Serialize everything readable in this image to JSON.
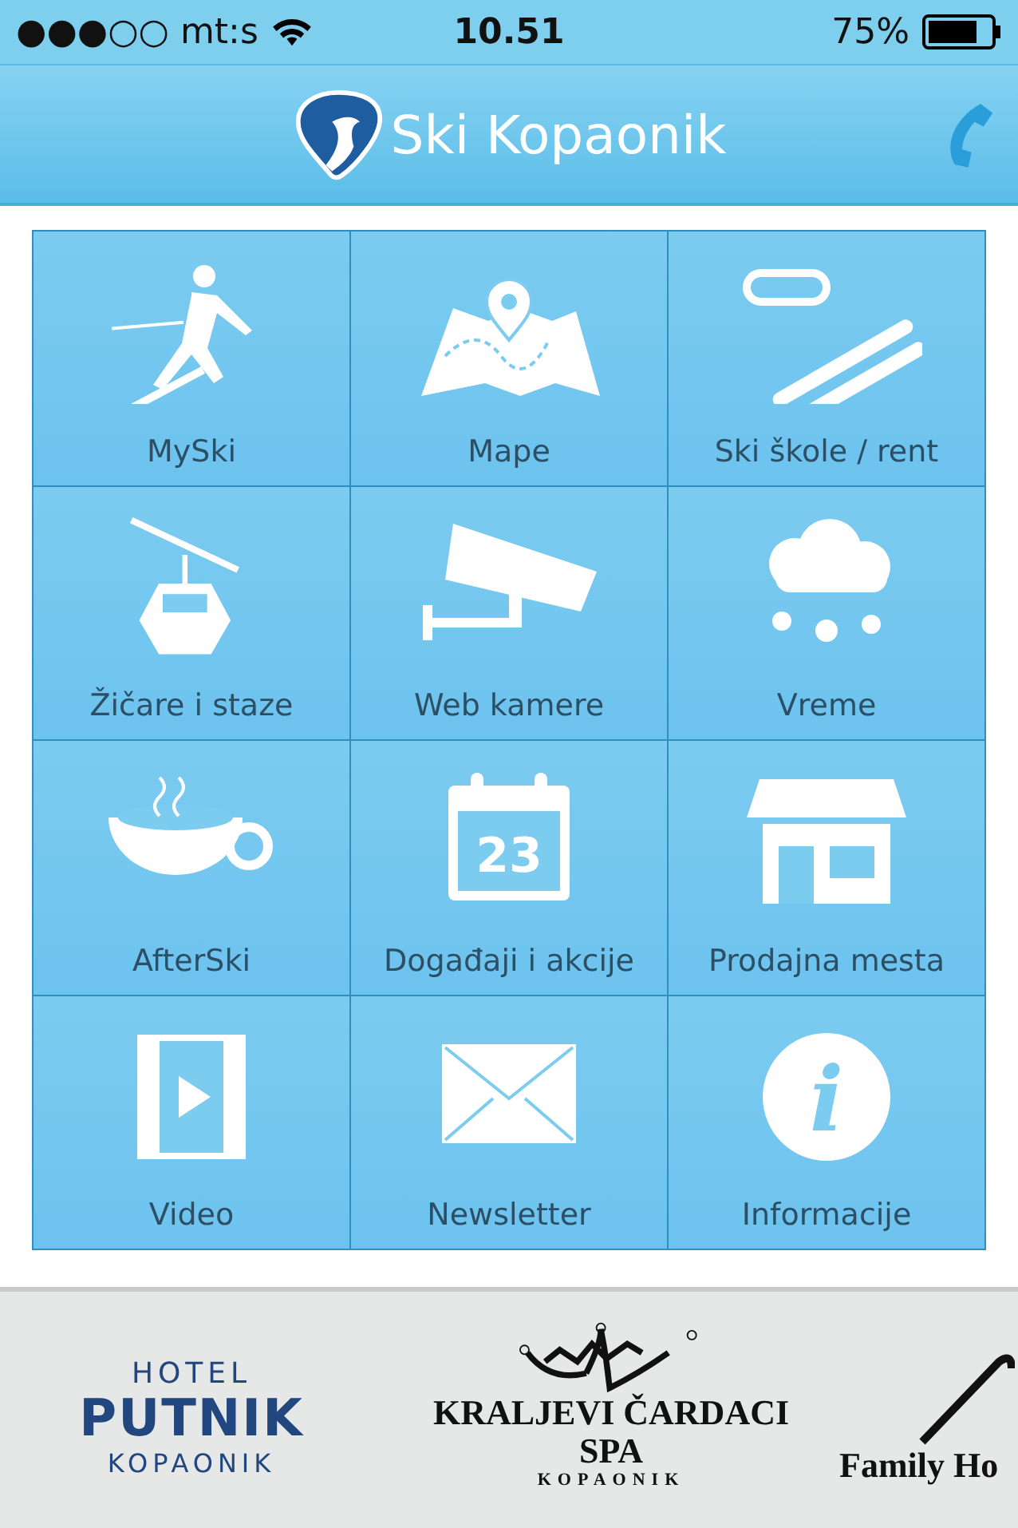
{
  "status_bar": {
    "carrier": "●●●○○ mt:s",
    "time": "10.51",
    "battery": "75%"
  },
  "header": {
    "title": "Ski Kopaonik"
  },
  "tiles": [
    {
      "label": "MySki",
      "kind": "skier"
    },
    {
      "label": "Mape",
      "kind": "map"
    },
    {
      "label": "Ski škole / rent",
      "kind": "skis"
    },
    {
      "label": "Žičare i staze",
      "kind": "gondola"
    },
    {
      "label": "Web kamere",
      "kind": "camera"
    },
    {
      "label": "Vreme",
      "kind": "snow"
    },
    {
      "label": "AfterSki",
      "kind": "cup"
    },
    {
      "label": "Događaji i akcije",
      "kind": "calendar",
      "icon_text": "23"
    },
    {
      "label": "Prodajna mesta",
      "kind": "shop"
    },
    {
      "label": "Video",
      "kind": "video"
    },
    {
      "label": "Newsletter",
      "kind": "mail"
    },
    {
      "label": "Informacije",
      "kind": "info",
      "icon_text": "i"
    }
  ],
  "sponsors": [
    {
      "kind": "putnik",
      "lines": [
        "HOTEL",
        "PUTNIK",
        "KOPAONIK"
      ]
    },
    {
      "kind": "cardaci",
      "lines": [
        "KRALJEVI ČARDACI",
        "SPA",
        "KOPAONIK"
      ]
    },
    {
      "kind": "family",
      "lines": [
        "Family Ho"
      ]
    }
  ]
}
